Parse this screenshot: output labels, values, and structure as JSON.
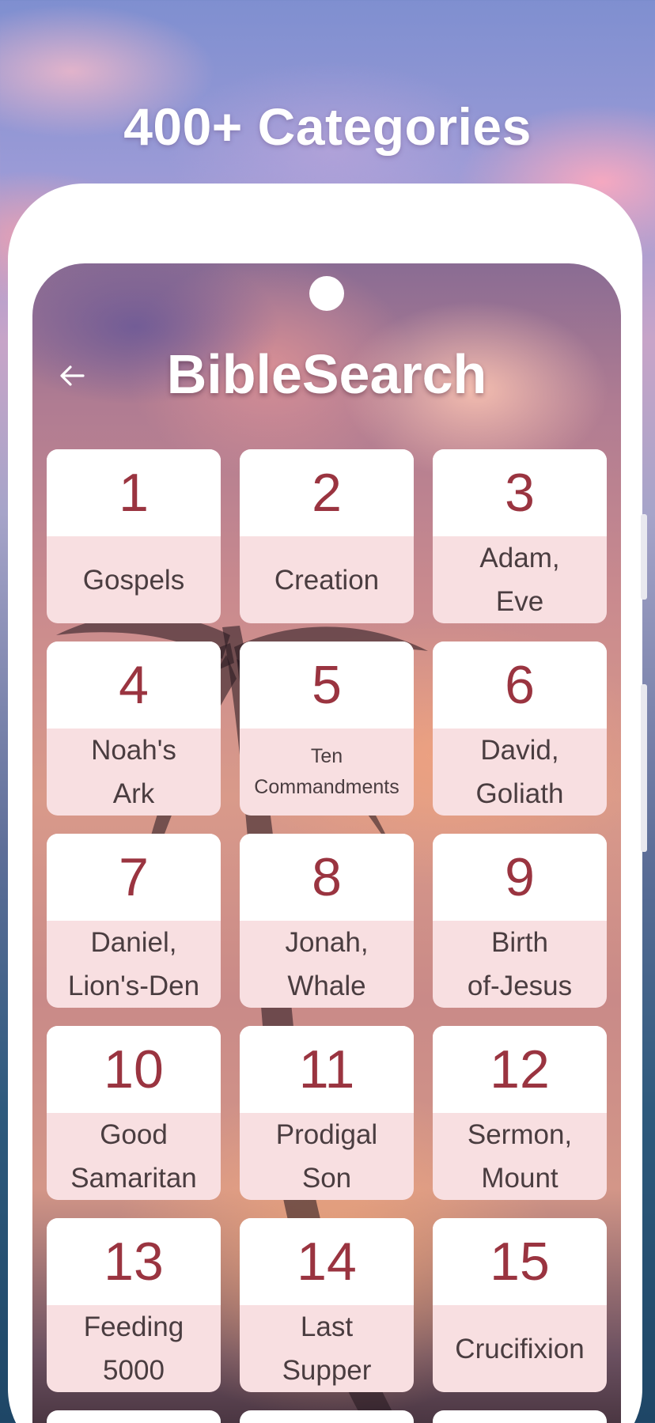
{
  "headline": "400+ Categories",
  "app": {
    "title": "BibleSearch",
    "back_icon": "arrow-left-icon"
  },
  "colors": {
    "number": "#9a3440",
    "label": "#4a3d40",
    "label_bg": "#f8dfe1",
    "card_top": "#ffffff"
  },
  "categories": [
    {
      "number": "1",
      "line1": "Gospels",
      "line2": ""
    },
    {
      "number": "2",
      "line1": "Creation",
      "line2": ""
    },
    {
      "number": "3",
      "line1": "Adam,",
      "line2": "Eve"
    },
    {
      "number": "4",
      "line1": "Noah's",
      "line2": "Ark"
    },
    {
      "number": "5",
      "line1": "Ten",
      "line2": "Commandments"
    },
    {
      "number": "6",
      "line1": "David,",
      "line2": "Goliath"
    },
    {
      "number": "7",
      "line1": "Daniel,",
      "line2": "Lion's-Den"
    },
    {
      "number": "8",
      "line1": "Jonah,",
      "line2": "Whale"
    },
    {
      "number": "9",
      "line1": "Birth",
      "line2": "of-Jesus"
    },
    {
      "number": "10",
      "line1": "Good",
      "line2": "Samaritan"
    },
    {
      "number": "11",
      "line1": "Prodigal",
      "line2": "Son"
    },
    {
      "number": "12",
      "line1": "Sermon,",
      "line2": "Mount"
    },
    {
      "number": "13",
      "line1": "Feeding",
      "line2": "5000"
    },
    {
      "number": "14",
      "line1": "Last",
      "line2": "Supper"
    },
    {
      "number": "15",
      "line1": "Crucifixion",
      "line2": ""
    }
  ]
}
